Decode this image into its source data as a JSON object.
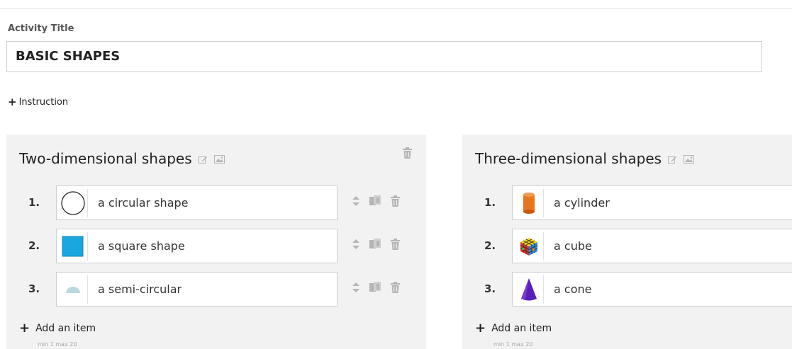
{
  "activity": {
    "label": "Activity Title",
    "value": "BASIC SHAPES"
  },
  "instruction_link": "Instruction",
  "groups": [
    {
      "title": "Two-dimensional shapes",
      "items": [
        {
          "num": "1.",
          "text": "a circular shape",
          "thumb": "circle-outline"
        },
        {
          "num": "2.",
          "text": "a square shape",
          "thumb": "blue-square"
        },
        {
          "num": "3.",
          "text": "a semi-circular",
          "thumb": "light-blue-semicircle"
        }
      ],
      "add_label": "Add an item",
      "limits": "min 1   max 20"
    },
    {
      "title": "Three-dimensional shapes",
      "items": [
        {
          "num": "1.",
          "text": "a cylinder",
          "thumb": "orange-cylinder"
        },
        {
          "num": "2.",
          "text": "a cube",
          "thumb": "rubik-cube"
        },
        {
          "num": "3.",
          "text": "a cone",
          "thumb": "purple-cone"
        }
      ],
      "add_label": "Add an item",
      "limits": "min 1   max 20"
    }
  ],
  "colors": {
    "square": "#1aa7e0",
    "semicircle": "#b9d9e1",
    "cylinder": "#e8761f",
    "cone": "#5a1fb8",
    "panel": "#f2f2f2"
  }
}
